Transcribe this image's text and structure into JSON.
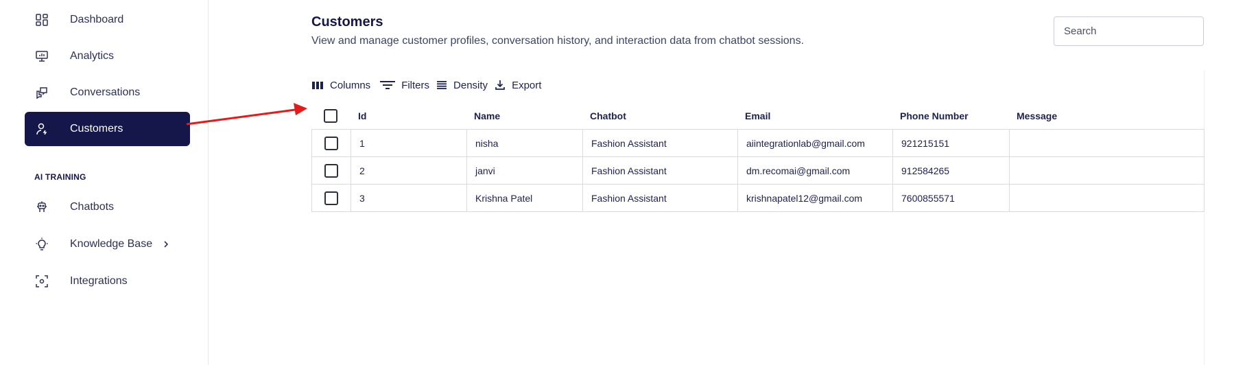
{
  "sidebar": {
    "items": [
      {
        "label": "Dashboard",
        "icon": "dashboard-icon"
      },
      {
        "label": "Analytics",
        "icon": "analytics-icon"
      },
      {
        "label": "Conversations",
        "icon": "conversations-icon"
      },
      {
        "label": "Customers",
        "icon": "customers-icon",
        "active": true
      }
    ],
    "section_title": "AI TRAINING",
    "training_items": [
      {
        "label": "Chatbots",
        "icon": "chatbot-icon"
      },
      {
        "label": "Knowledge Base",
        "icon": "lightbulb-icon",
        "has_chevron": true
      },
      {
        "label": "Integrations",
        "icon": "integrations-icon"
      }
    ]
  },
  "header": {
    "title": "Customers",
    "subtitle": "View and manage customer profiles, conversation history, and interaction data from chatbot sessions."
  },
  "search": {
    "placeholder": "Search",
    "value": ""
  },
  "toolbar": {
    "columns_label": "Columns",
    "filters_label": "Filters",
    "density_label": "Density",
    "export_label": "Export"
  },
  "table": {
    "columns": [
      "Id",
      "Name",
      "Chatbot",
      "Email",
      "Phone Number",
      "Message"
    ],
    "rows": [
      {
        "id": "1",
        "name": "nisha",
        "chatbot": "Fashion Assistant",
        "email": "aiintegrationlab@gmail.com",
        "phone": "921215151",
        "message": ""
      },
      {
        "id": "2",
        "name": "janvi",
        "chatbot": "Fashion Assistant",
        "email": "dm.recomai@gmail.com",
        "phone": "912584265",
        "message": ""
      },
      {
        "id": "3",
        "name": "Krishna Patel",
        "chatbot": "Fashion Assistant",
        "email": "krishnapatel12@gmail.com",
        "phone": "7600855571",
        "message": ""
      }
    ]
  },
  "colors": {
    "active_bg": "#15164a",
    "text": "#1b2150",
    "annotation_arrow": "#e81919"
  }
}
